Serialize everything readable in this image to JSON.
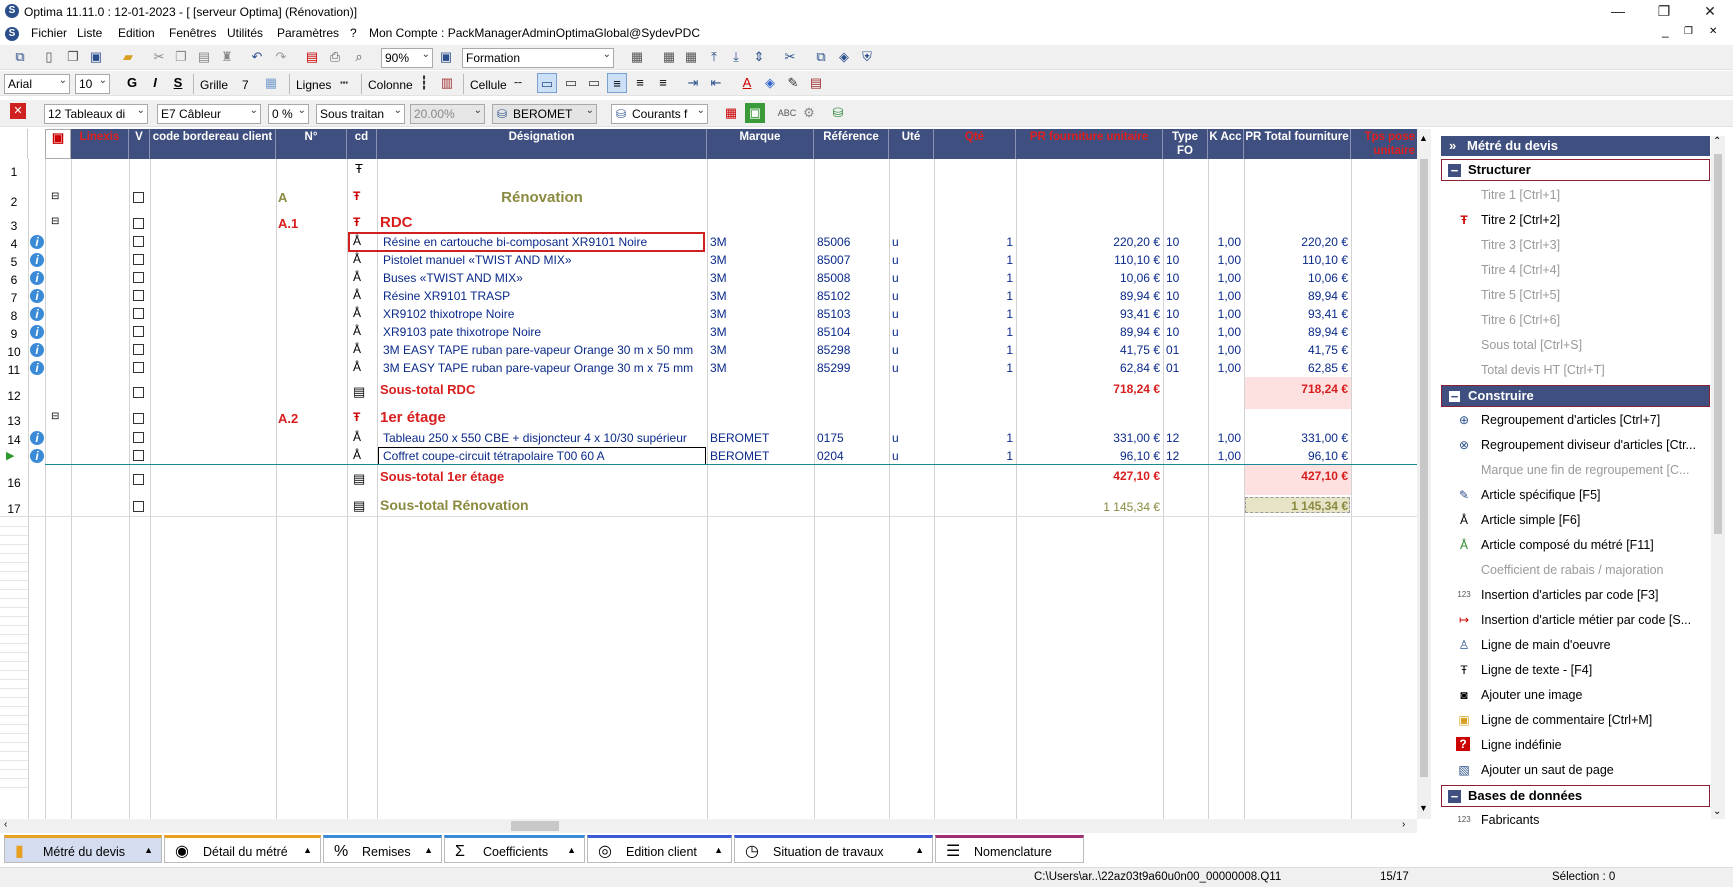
{
  "window": {
    "title": "Optima 11.11.0 : 12-01-2023 - [ [serveur Optima] (Rénovation)]",
    "minimize": "—",
    "maximize": "❐",
    "close": "✕"
  },
  "menu": {
    "items": [
      "Fichier",
      "Liste",
      "Edition",
      "Fenêtres",
      "Utilités",
      "Paramètres",
      "?",
      "Mon Compte : PackManagerAdminOptimaGlobal@SydevPDC"
    ],
    "mdi": [
      "_",
      "❐",
      "✕"
    ]
  },
  "toolbar1": {
    "zoom": "90%",
    "style": "Formation"
  },
  "toolbar2": {
    "font": "Arial",
    "size": "10",
    "bold": "G",
    "italic": "I",
    "strike": "S",
    "grille_label": "Grille",
    "grille_value": "7",
    "lignes_label": "Lignes",
    "colonne_label": "Colonne",
    "cellule_label": "Cellule"
  },
  "toolbar3": {
    "tableaux": "12 Tableaux di",
    "cableur": "E7 Câbleur",
    "pct": "0 %",
    "sous_traitant": "Sous traitan",
    "rate": "20.00%",
    "supplier": "BEROMET",
    "courants": "Courants f"
  },
  "columns": {
    "linexis": "Linexis",
    "v": "V",
    "code_bordereau": "code bordereau client",
    "num": "N°",
    "cd": "cd",
    "designation": "Désignation",
    "marque": "Marque",
    "reference": "Référence",
    "ute": "Uté",
    "qte": "Qté",
    "pr_unit": "PR fourniture unitaire",
    "type_fo": "Type FO",
    "k_acc": "K Acc",
    "pr_total": "PR Total fourniture",
    "tps": "Tps pose unitaire"
  },
  "rows": [
    {
      "n": "1"
    },
    {
      "n": "2",
      "num": "A",
      "title": "Rénovation"
    },
    {
      "n": "3",
      "num": "A.1",
      "title": "RDC"
    },
    {
      "n": "4",
      "designation": "Résine en cartouche bi-composant XR9101 Noire",
      "marque": "3M",
      "ref": "85006",
      "ute": "u",
      "qte": "1",
      "pr": "220,20 €",
      "type": "10",
      "k": "1,00",
      "total": "220,20 €"
    },
    {
      "n": "5",
      "designation": "Pistolet manuel «TWIST AND MIX»",
      "marque": "3M",
      "ref": "85007",
      "ute": "u",
      "qte": "1",
      "pr": "110,10 €",
      "type": "10",
      "k": "1,00",
      "total": "110,10 €"
    },
    {
      "n": "6",
      "designation": "Buses «TWIST AND MIX»",
      "marque": "3M",
      "ref": "85008",
      "ute": "u",
      "qte": "1",
      "pr": "10,06 €",
      "type": "10",
      "k": "1,00",
      "total": "10,06 €"
    },
    {
      "n": "7",
      "designation": "Résine XR9101 TRASP",
      "marque": "3M",
      "ref": "85102",
      "ute": "u",
      "qte": "1",
      "pr": "89,94 €",
      "type": "10",
      "k": "1,00",
      "total": "89,94 €"
    },
    {
      "n": "8",
      "designation": "XR9102 thixotrope Noire",
      "marque": "3M",
      "ref": "85103",
      "ute": "u",
      "qte": "1",
      "pr": "93,41 €",
      "type": "10",
      "k": "1,00",
      "total": "93,41 €"
    },
    {
      "n": "9",
      "designation": "XR9103 pate thixotrope Noire",
      "marque": "3M",
      "ref": "85104",
      "ute": "u",
      "qte": "1",
      "pr": "89,94 €",
      "type": "10",
      "k": "1,00",
      "total": "89,94 €"
    },
    {
      "n": "10",
      "designation": "3M EASY TAPE ruban pare-vapeur Orange 30 m x 50 mm",
      "marque": "3M",
      "ref": "85298",
      "ute": "u",
      "qte": "1",
      "pr": "41,75 €",
      "type": "01",
      "k": "1,00",
      "total": "41,75 €"
    },
    {
      "n": "11",
      "designation": "3M EASY TAPE ruban pare-vapeur Orange 30 m x 75 mm",
      "marque": "3M",
      "ref": "85299",
      "ute": "u",
      "qte": "1",
      "pr": "62,84 €",
      "type": "01",
      "k": "1,00",
      "total": "62,85 €"
    },
    {
      "n": "12",
      "subtotal": "Sous-total RDC",
      "pr": "718,24 €",
      "total": "718,24 €"
    },
    {
      "n": "13",
      "num": "A.2",
      "title": "1er étage"
    },
    {
      "n": "14",
      "designation": "Tableau 250 x 550 CBE + disjoncteur 4 x 10/30 supérieur",
      "marque": "BEROMET",
      "ref": "0175",
      "ute": "u",
      "qte": "1",
      "pr": "331,00 €",
      "type": "12",
      "k": "1,00",
      "total": "331,00 €"
    },
    {
      "n": "",
      "designation": "Coffret coupe-circuit tétrapolaire T00 60 A",
      "marque": "BEROMET",
      "ref": "0204",
      "ute": "u",
      "qte": "1",
      "pr": "96,10 €",
      "type": "12",
      "k": "1,00",
      "total": "96,10 €"
    },
    {
      "n": "16",
      "subtotal": "Sous-total 1er étage",
      "pr": "427,10 €",
      "total": "427,10 €"
    },
    {
      "n": "17",
      "subtotal": "Sous-total Rénovation",
      "pr": "1 145,34 €",
      "total": "1 145,34 €"
    }
  ],
  "panel": {
    "header": "Métré du devis",
    "structurer": "Structurer",
    "titles": [
      "Titre 1 [Ctrl+1]",
      "Titre 2 [Ctrl+2]",
      "Titre 3 [Ctrl+3]",
      "Titre 4 [Ctrl+4]",
      "Titre 5 [Ctrl+5]",
      "Titre 6 [Ctrl+6]",
      "Sous total [Ctrl+S]",
      "Total devis HT [Ctrl+T]"
    ],
    "construire": "Construire",
    "build": [
      "Regroupement d'articles [Ctrl+7]",
      "Regroupement diviseur d'articles [Ctr...",
      "Marque une fin de regroupement [C...",
      "Article spécifique [F5]",
      "Article simple [F6]",
      "Article composé du métré [F11]",
      "Coefficient de rabais / majoration",
      "Insertion d'articles par code [F3]",
      "Insertion d'article métier par code [S...",
      "Ligne de main d'oeuvre",
      "Ligne de texte - [F4]",
      "Ajouter une image",
      "Ligne de commentaire [Ctrl+M]",
      "Ligne indéfinie",
      "Ajouter un saut de page"
    ],
    "bases": "Bases de données",
    "fabricants": "Fabricants"
  },
  "tabs": [
    "Métré du devis",
    "Détail du métré",
    "Remises",
    "Coefficients",
    "Edition client",
    "Situation de travaux",
    "Nomenclature"
  ],
  "status": {
    "path": "C:\\Users\\ar..\\22az03t9a60u0n00_00000008.Q11",
    "pos": "15/17",
    "selection": "Sélection : 0"
  }
}
